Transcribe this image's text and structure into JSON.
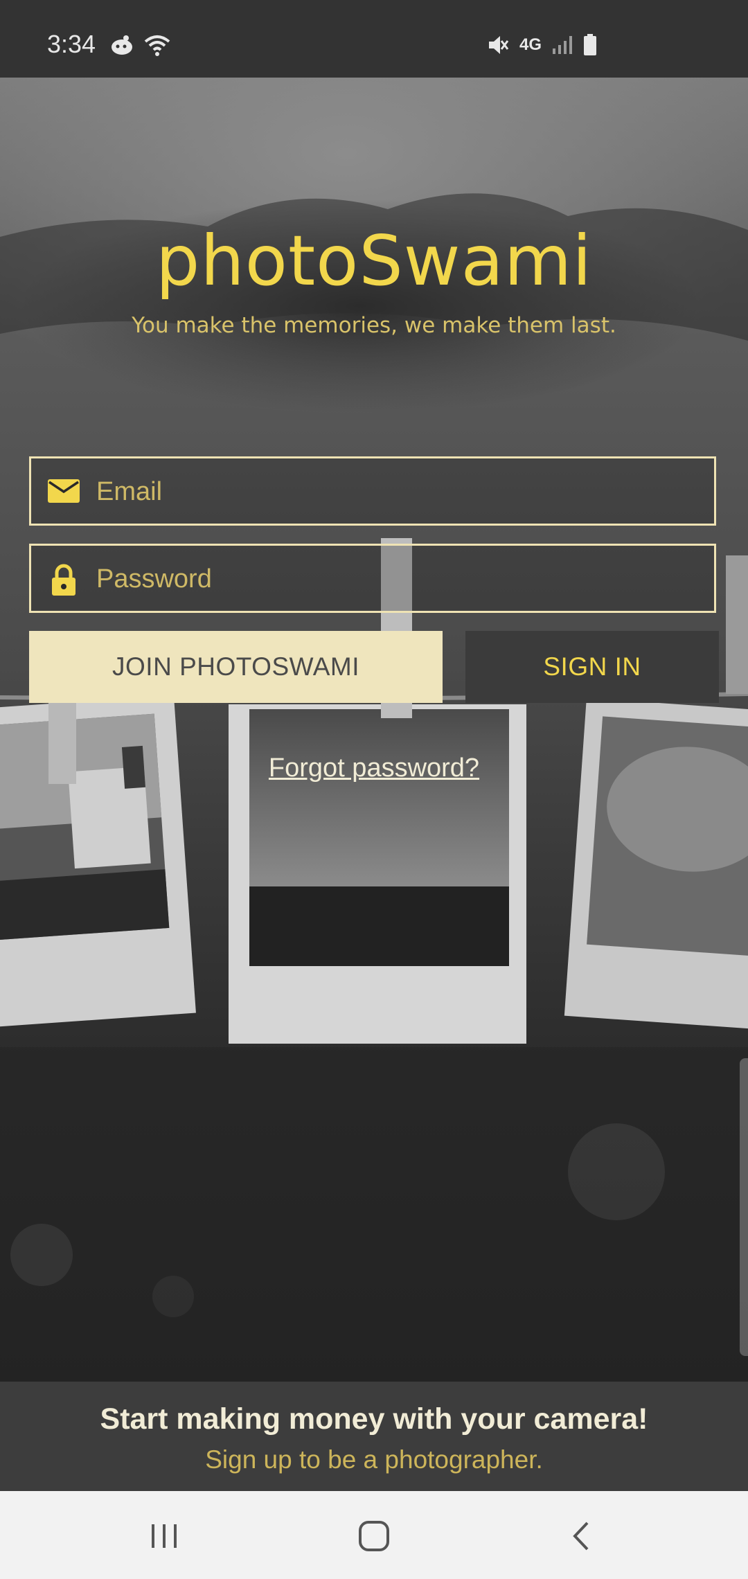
{
  "status_bar": {
    "time": "3:34",
    "network": "4G"
  },
  "app": {
    "logo": "photoSwami",
    "tagline": "You make the memories, we make them last."
  },
  "login_form": {
    "email_placeholder": "Email",
    "password_placeholder": "Password",
    "join_label": "JOIN PHOTOSWAMI",
    "signin_label": "SIGN IN",
    "forgot_label": "Forgot password?"
  },
  "promo": {
    "title": "Start making money with your camera!",
    "subtitle": "Sign up to be a photographer."
  },
  "nav": {
    "icons": [
      "recents-icon",
      "home-icon",
      "back-icon"
    ]
  },
  "colors": {
    "accent_yellow": "#f2d74c",
    "cream": "#efe5bd",
    "dark": "#3b3b3b"
  }
}
